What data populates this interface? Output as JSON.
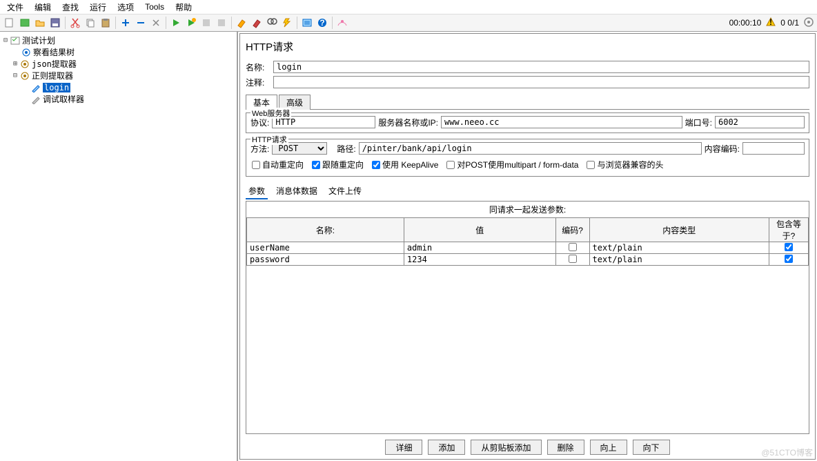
{
  "menu": [
    "文件",
    "编辑",
    "查找",
    "运行",
    "选项",
    "Tools",
    "帮助"
  ],
  "status": {
    "time": "00:00:10",
    "count": "0  0/1"
  },
  "tree": {
    "root": "测试计划",
    "items": [
      "察看结果树",
      "json提取器",
      "正则提取器",
      "login",
      "调试取样器"
    ]
  },
  "panel": {
    "title": "HTTP请求",
    "name_label": "名称:",
    "name_value": "login",
    "comment_label": "注释:",
    "comment_value": "",
    "tabs": {
      "basic": "基本",
      "advanced": "高级"
    },
    "web_server": {
      "legend": "Web服务器",
      "protocol_label": "协议:",
      "protocol_value": "HTTP",
      "server_label": "服务器名称或IP:",
      "server_value": "www.neeo.cc",
      "port_label": "端口号:",
      "port_value": "6002"
    },
    "http_request": {
      "legend": "HTTP请求",
      "method_label": "方法:",
      "method_value": "POST",
      "path_label": "路径:",
      "path_value": "/pinter/bank/api/login",
      "encoding_label": "内容编码:",
      "encoding_value": "",
      "checkboxes": {
        "auto_redirect": "自动重定向",
        "follow_redirect": "跟随重定向",
        "keepalive": "使用 KeepAlive",
        "multipart": "对POST使用multipart / form-data",
        "browser_headers": "与浏览器兼容的头"
      }
    },
    "subtabs": {
      "params": "参数",
      "body": "消息体数据",
      "files": "文件上传"
    },
    "params_title": "同请求一起发送参数:",
    "params_headers": {
      "name": "名称:",
      "value": "值",
      "encode": "编码?",
      "ctype": "内容类型",
      "include": "包含等于?"
    },
    "params_rows": [
      {
        "name": "userName",
        "value": "admin",
        "encode": false,
        "ctype": "text/plain",
        "include": true
      },
      {
        "name": "password",
        "value": "1234",
        "encode": false,
        "ctype": "text/plain",
        "include": true
      }
    ],
    "buttons": {
      "detail": "详细",
      "add": "添加",
      "clipboard": "从剪贴板添加",
      "delete": "删除",
      "up": "向上",
      "down": "向下"
    }
  },
  "watermark": "@51CTO博客"
}
